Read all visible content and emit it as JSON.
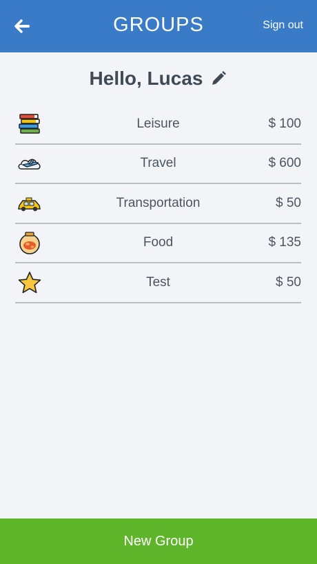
{
  "header": {
    "title": "GROUPS",
    "signout_label": "Sign out",
    "back_icon": "arrow-left-icon",
    "color": "#3a7bc8"
  },
  "greeting": {
    "text": "Hello, Lucas",
    "edit_icon": "pencil-icon"
  },
  "groups": [
    {
      "name": "Leisure",
      "amount": "$ 100",
      "icon": "books-icon"
    },
    {
      "name": "Travel",
      "amount": "$ 600",
      "icon": "airplane-cloud-icon"
    },
    {
      "name": "Transportation",
      "amount": "$ 50",
      "icon": "taxi-icon"
    },
    {
      "name": "Food",
      "amount": "$ 135",
      "icon": "food-jar-icon"
    },
    {
      "name": "Test",
      "amount": "$ 50",
      "icon": "star-icon"
    }
  ],
  "footer": {
    "new_group_label": "New Group",
    "color": "#5eb52a"
  }
}
